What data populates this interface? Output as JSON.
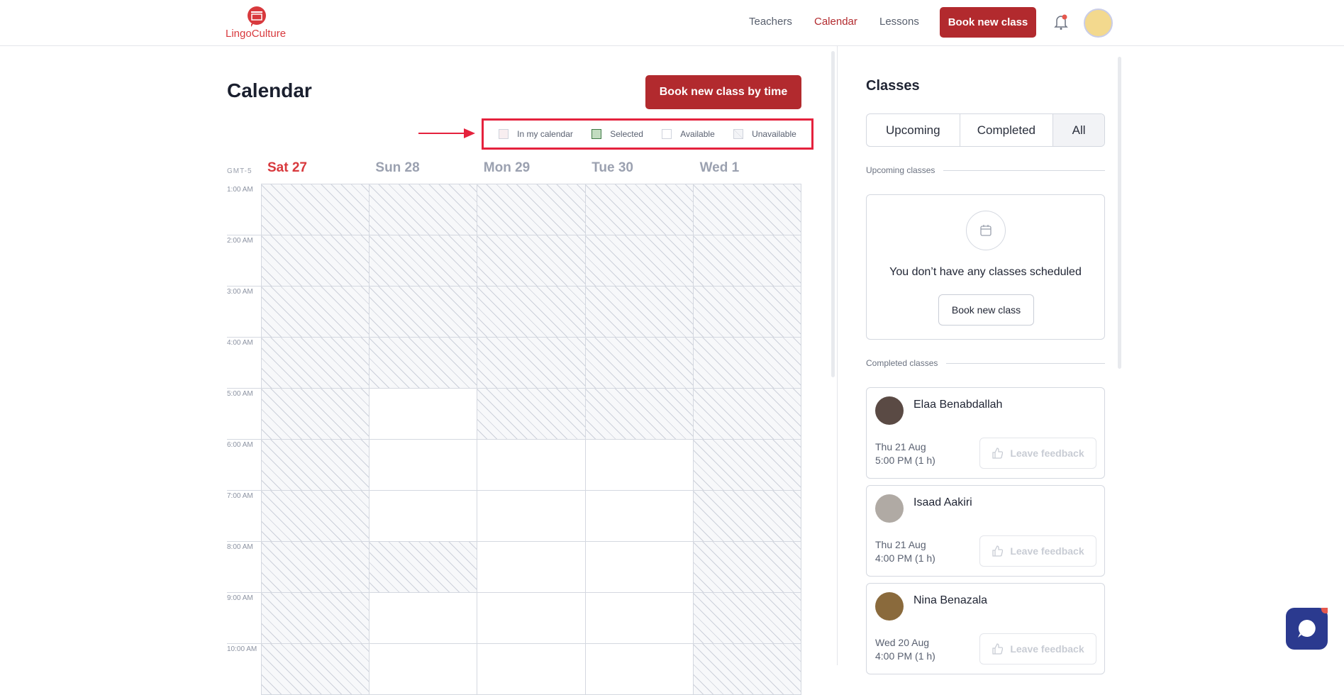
{
  "header": {
    "logo_text": "LingoCulture",
    "nav": [
      "Teachers",
      "Calendar",
      "Lessons"
    ],
    "active_nav": "Calendar",
    "book_button": "Book new class"
  },
  "calendar": {
    "title": "Calendar",
    "book_by_time": "Book new class by time",
    "timezone": "GMT-5",
    "legend": [
      {
        "label": "In my calendar",
        "color": "#f8eef0"
      },
      {
        "label": "Selected",
        "color": "#c2dcc0"
      },
      {
        "label": "Available",
        "color": "#ffffff"
      },
      {
        "label": "Unavailable",
        "color": "hatched"
      }
    ],
    "days": [
      "Sat 27",
      "Sun 28",
      "Mon 29",
      "Tue 30",
      "Wed 1"
    ],
    "hours": [
      "1:00 AM",
      "2:00 AM",
      "3:00 AM",
      "4:00 AM",
      "5:00 AM",
      "6:00 AM",
      "7:00 AM",
      "8:00 AM",
      "9:00 AM",
      "10:00 AM"
    ],
    "availability": [
      "UUUUU",
      "UUUUU",
      "UUUUU",
      "UUUUU",
      "UAUUU",
      "UAAAU",
      "UAAAU",
      "UUAAU",
      "UAAAU",
      "UAAAU"
    ]
  },
  "classes": {
    "title": "Classes",
    "tabs": [
      "Upcoming",
      "Completed",
      "All"
    ],
    "active_tab": "All",
    "upcoming_label": "Upcoming classes",
    "empty_text": "You don’t have any classes scheduled",
    "empty_button": "Book new class",
    "completed_label": "Completed classes",
    "completed": [
      {
        "teacher": "Elaa Benabdallah",
        "date": "Thu 21 Aug",
        "time": "5:00 PM (1 h)",
        "action": "Leave feedback",
        "avatar_color": "#5a4a44"
      },
      {
        "teacher": "Isaad Aakiri",
        "date": "Thu 21 Aug",
        "time": "4:00 PM (1 h)",
        "action": "Leave feedback",
        "avatar_color": "#b0aaa4"
      },
      {
        "teacher": "Nina Benazala",
        "date": "Wed 20 Aug",
        "time": "4:00 PM (1 h)",
        "action": "Leave feedback",
        "avatar_color": "#8a6a3c"
      }
    ]
  },
  "colors": {
    "brand": "#b22a2e",
    "highlight": "#e5223d"
  }
}
